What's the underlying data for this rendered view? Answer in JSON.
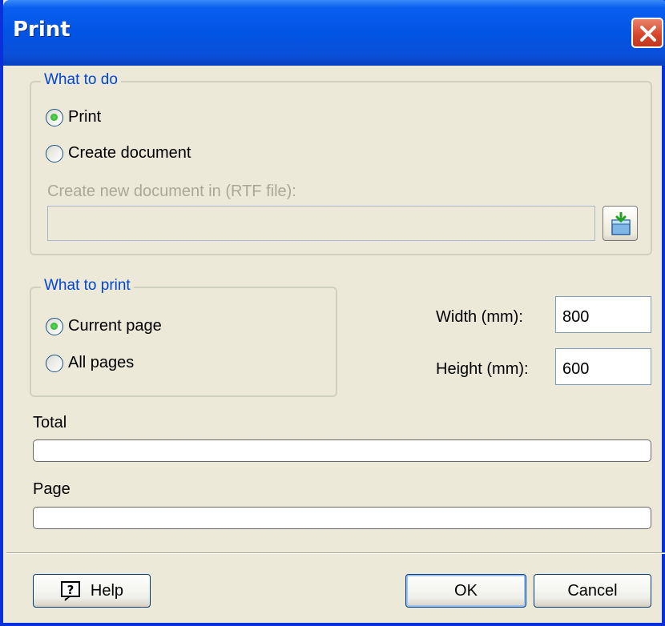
{
  "window": {
    "title": "Print"
  },
  "what_to_do": {
    "title": "What to do",
    "options": [
      {
        "label": "Print",
        "checked": true
      },
      {
        "label": "Create document",
        "checked": false
      }
    ],
    "file_label": "Create new document in (RTF file):",
    "file_value": "",
    "browse_icon": "folder-download-icon"
  },
  "what_to_print": {
    "title": "What to print",
    "options": [
      {
        "label": "Current page",
        "checked": true
      },
      {
        "label": "All pages",
        "checked": false
      }
    ]
  },
  "size": {
    "width_label": "Width (mm):",
    "width_value": "800",
    "height_label": "Height (mm):",
    "height_value": "600"
  },
  "progress": {
    "total_label": "Total",
    "total_value": 0,
    "page_label": "Page",
    "page_value": 0
  },
  "buttons": {
    "help": "Help",
    "ok": "OK",
    "cancel": "Cancel"
  }
}
